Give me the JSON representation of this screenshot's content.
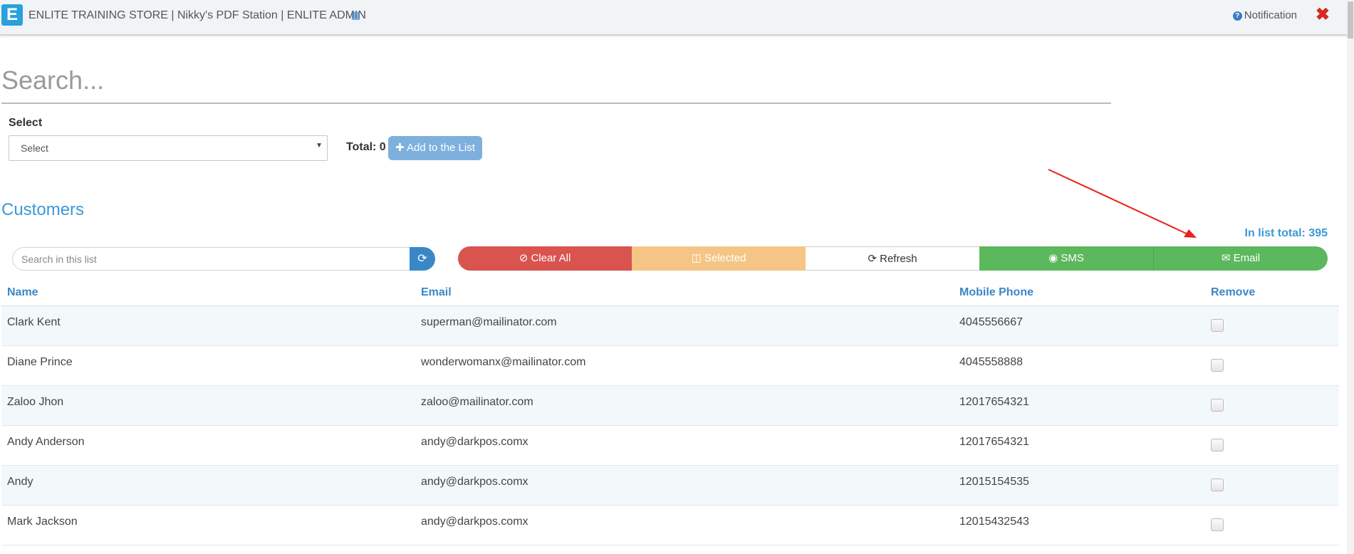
{
  "header": {
    "title": "ENLITE TRAINING STORE | Nikky's PDF Station | ENLITE ADMIN",
    "logo_letter": "E",
    "notification_label": "Notification"
  },
  "search": {
    "placeholder": "Search..."
  },
  "select": {
    "label": "Select",
    "value": "Select"
  },
  "total": {
    "label": "Total: 0"
  },
  "add_button": {
    "label": "Add to the List"
  },
  "section": {
    "title": "Customers",
    "in_list_total": "In list total: 395"
  },
  "list_search": {
    "placeholder": "Search in this list"
  },
  "actions": {
    "clear_all": "Clear All",
    "selected": "Selected",
    "refresh": "Refresh",
    "sms": "SMS",
    "email": "Email"
  },
  "table": {
    "headers": {
      "name": "Name",
      "email": "Email",
      "phone": "Mobile Phone",
      "remove": "Remove"
    },
    "rows": [
      {
        "name": "Clark Kent",
        "email": "superman@mailinator.com",
        "phone": "4045556667"
      },
      {
        "name": "Diane Prince",
        "email": "wonderwomanx@mailinator.com",
        "phone": "4045558888"
      },
      {
        "name": "Zaloo Jhon",
        "email": "zaloo@mailinator.com",
        "phone": "12017654321"
      },
      {
        "name": "Andy Anderson",
        "email": "andy@darkpos.comx",
        "phone": "12017654321"
      },
      {
        "name": "Andy",
        "email": "andy@darkpos.comx",
        "phone": "12015154535"
      },
      {
        "name": "Mark Jackson",
        "email": "andy@darkpos.comx",
        "phone": "12015432543"
      }
    ]
  },
  "colors": {
    "accent": "#3b99d4",
    "danger": "#d9534f",
    "warning": "#f5c585",
    "success": "#5cb85c",
    "annotation_arrow": "#e8231b"
  }
}
